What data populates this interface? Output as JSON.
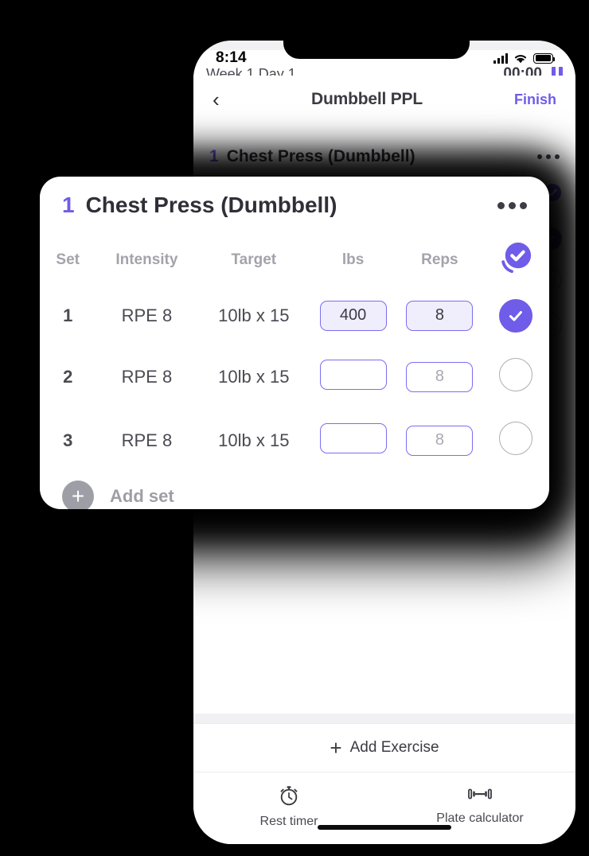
{
  "status_bar": {
    "time": "8:14",
    "signal_icon": "cellular-signal-icon",
    "wifi_icon": "wifi-icon",
    "battery_icon": "battery-icon"
  },
  "nav": {
    "back_icon": "chevron-left-icon",
    "title": "Dumbbell PPL",
    "action_label": "Finish"
  },
  "session": {
    "week_day": "Week 1 Day 1",
    "timer": "00:00",
    "pause_icon": "pause-icon"
  },
  "exercise": {
    "index": "1",
    "name": "Chest Press (Dumbbell)",
    "menu_icon": "more-options-icon",
    "check_all_icon": "check-all-icon",
    "columns": [
      "Set",
      "Intensity",
      "Target",
      "lbs",
      "Reps",
      ""
    ],
    "rows": [
      {
        "set": "1",
        "intensity": "RPE 8",
        "target": "10lb x 15",
        "lbs_value": "400",
        "lbs_placeholder": "",
        "reps_value": "8",
        "reps_placeholder": "",
        "completed": true
      },
      {
        "set": "2",
        "intensity": "RPE 8",
        "target": "10lb x 15",
        "lbs_value": "",
        "lbs_placeholder": "",
        "reps_value": "",
        "reps_placeholder": "8",
        "completed": false
      },
      {
        "set": "3",
        "intensity": "RPE 8",
        "target": "10lb x 15",
        "lbs_value": "",
        "lbs_placeholder": "",
        "reps_value": "",
        "reps_placeholder": "8",
        "completed": false
      }
    ],
    "add_set_label": "Add set",
    "add_set_icon": "plus-circle-icon"
  },
  "bottom": {
    "add_exercise_label": "Add Exercise",
    "add_exercise_icon": "plus-icon",
    "tabs": [
      {
        "label": "Rest timer",
        "icon": "stopwatch-icon"
      },
      {
        "label": "Plate calculator",
        "icon": "dumbbell-icon"
      }
    ]
  },
  "colors": {
    "accent_purple": "#6f5ce8",
    "input_border": "#7c6df2",
    "input_fill": "#f0eefc",
    "text_dark": "#3b3b43",
    "text_muted": "#9e9ea6",
    "screen_bg": "#ffffff",
    "page_bg": "#000000"
  }
}
